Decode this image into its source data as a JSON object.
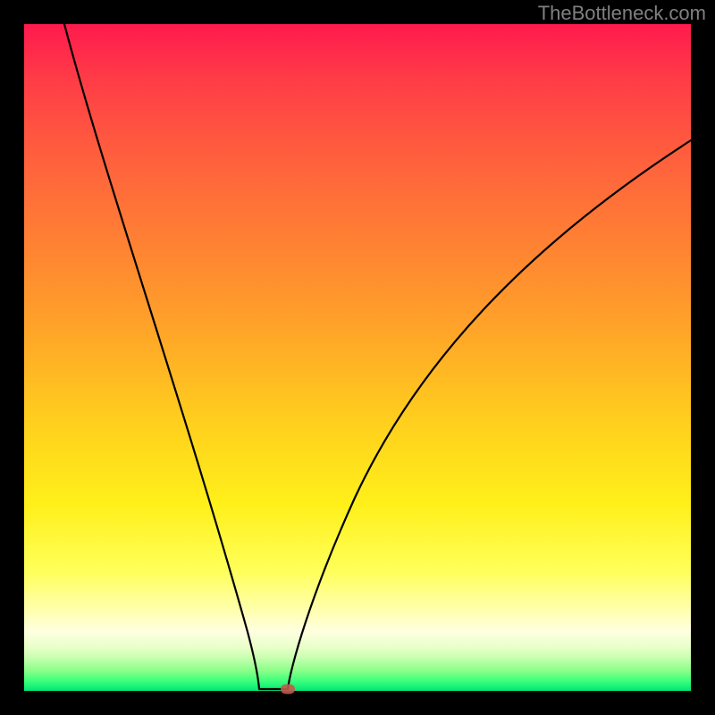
{
  "watermark": "TheBottleneck.com",
  "chart_data": {
    "type": "line",
    "title": "",
    "xlabel": "",
    "ylabel": "",
    "xlim": [
      0,
      100
    ],
    "ylim": [
      0,
      100
    ],
    "grid": false,
    "series": [
      {
        "name": "left-branch",
        "x": [
          6,
          9,
          12,
          15,
          18,
          21,
          24,
          27,
          30,
          33,
          35,
          37
        ],
        "y": [
          100,
          89,
          78,
          67,
          56,
          46,
          36,
          26,
          17,
          8,
          2,
          0
        ]
      },
      {
        "name": "right-branch",
        "x": [
          39.5,
          41,
          44,
          48,
          53,
          59,
          66,
          74,
          83,
          92,
          100
        ],
        "y": [
          0,
          7,
          20,
          33,
          44,
          54,
          62,
          69,
          74.5,
          79,
          82.5
        ]
      },
      {
        "name": "flat-minimum",
        "x": [
          35,
          39.5
        ],
        "y": [
          0,
          0
        ]
      }
    ],
    "marker": {
      "x": 39.5,
      "y": 0,
      "color": "#c15a4a"
    },
    "colors": {
      "curve": "#000000",
      "background_top": "#ff1a4d",
      "background_bottom": "#00e676",
      "frame": "#000000"
    }
  }
}
